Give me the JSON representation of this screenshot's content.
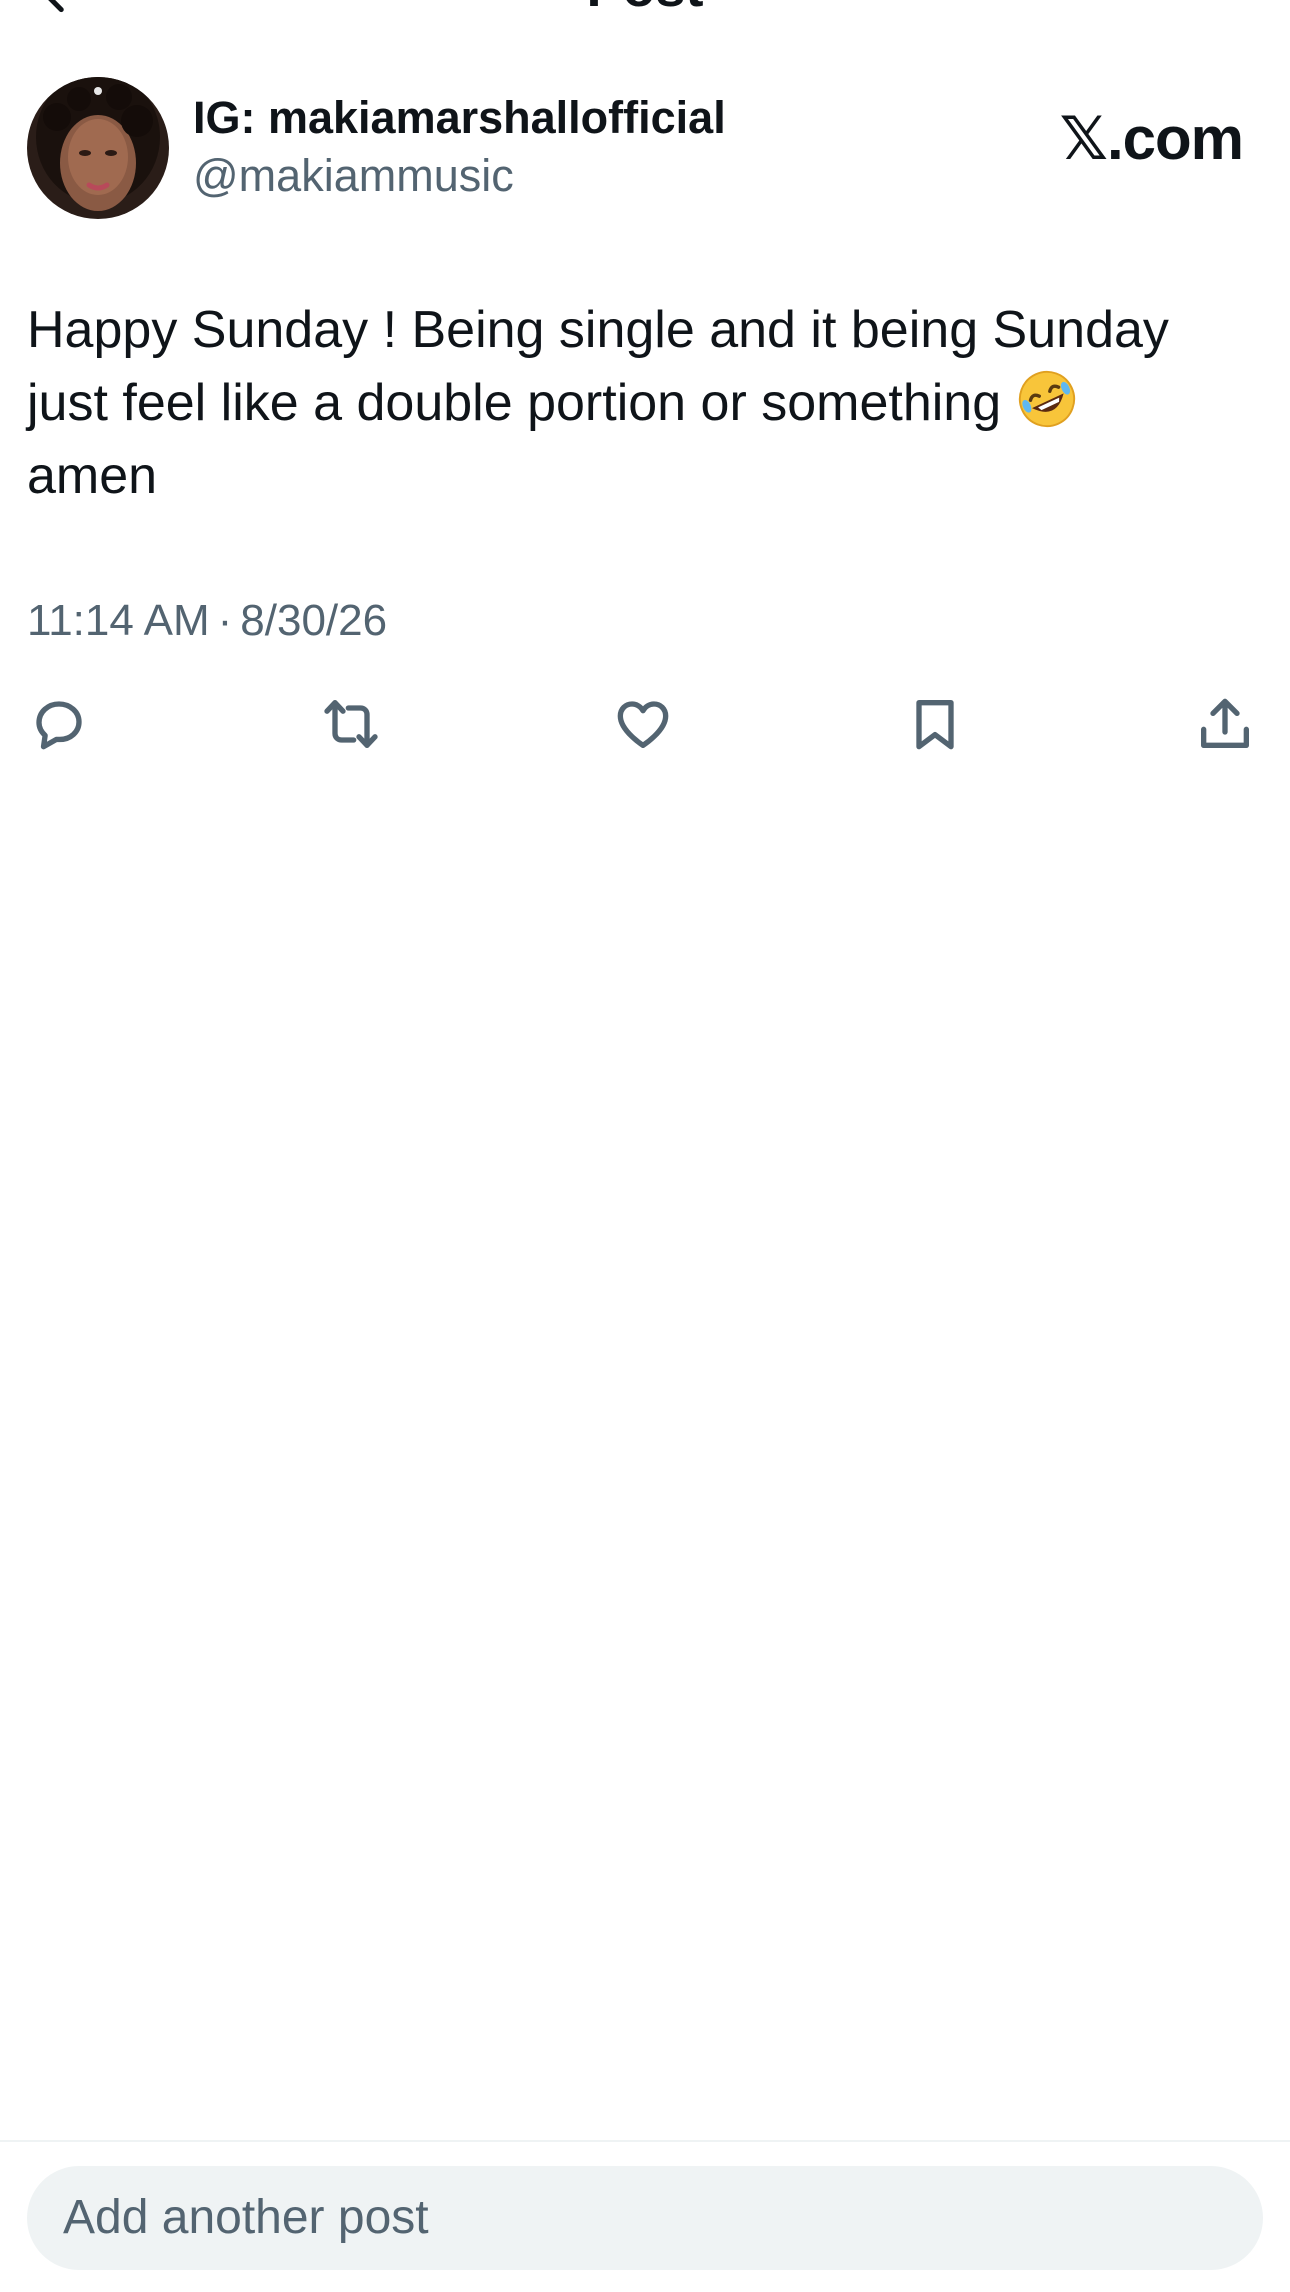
{
  "topbar": {
    "title": "Post",
    "back_icon": "arrow-left-icon"
  },
  "author": {
    "display_name": "IG: makiamarshallofficial",
    "handle": "@makiammusic",
    "avatar": "avatar-photo"
  },
  "brand": {
    "label": "𝕏.com"
  },
  "post": {
    "line1": "Happy Sunday ! Being single and it being Sunday",
    "line2": "just feel like a double portion or something",
    "emoji": "rolling-on-the-floor-laughing-emoji",
    "line3": "amen"
  },
  "meta": {
    "time": "11:14 AM",
    "separator": "·",
    "date": "8/30/26"
  },
  "actions": [
    {
      "name": "reply",
      "icon": "reply-icon"
    },
    {
      "name": "repost",
      "icon": "repost-icon"
    },
    {
      "name": "like",
      "icon": "heart-icon"
    },
    {
      "name": "bookmark",
      "icon": "bookmark-icon"
    },
    {
      "name": "share",
      "icon": "share-icon"
    }
  ],
  "composer": {
    "placeholder": "Add another post"
  },
  "colors": {
    "text_primary": "#0f1419",
    "text_secondary": "#536471",
    "composer_bg": "#eff3f4"
  }
}
